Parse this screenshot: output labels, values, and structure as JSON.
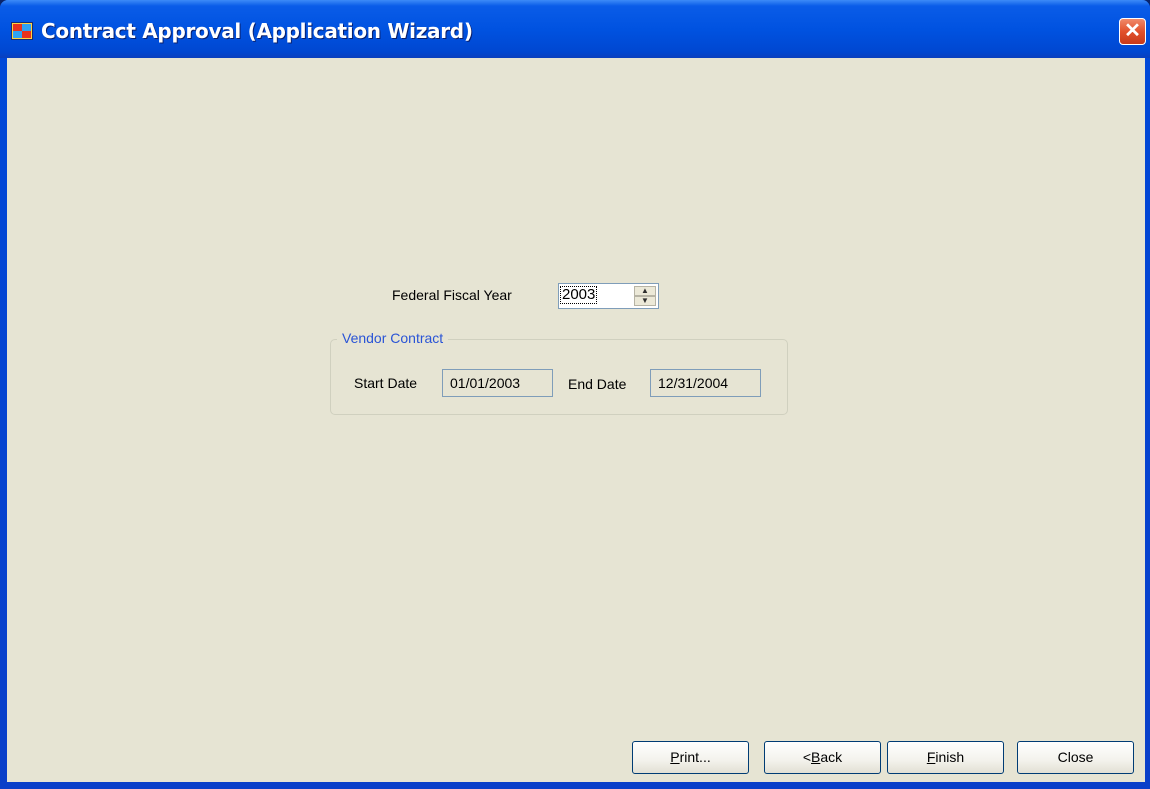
{
  "window": {
    "title": "Contract Approval (Application Wizard)",
    "icon": "application-icon",
    "close_glyph": "✕"
  },
  "form": {
    "fiscal_year_label": "Federal Fiscal Year",
    "fiscal_year_value": "2003",
    "spin_up_glyph": "▲",
    "spin_down_glyph": "▼"
  },
  "vendor_contract": {
    "group_title": "Vendor Contract",
    "start_date_label": "Start Date",
    "start_date_value": "01/01/2003",
    "end_date_label": "End Date",
    "end_date_value": "12/31/2004"
  },
  "buttons": {
    "print": {
      "mnemonic": "P",
      "rest": "rint..."
    },
    "back": {
      "prefix": "<",
      "mnemonic": "B",
      "rest": "ack"
    },
    "finish": {
      "mnemonic": "F",
      "rest": "inish"
    },
    "close": {
      "label": "Close"
    }
  },
  "colors": {
    "titlebar": "#0052e0",
    "client_bg": "#e6e4d3",
    "group_title": "#2a54d6",
    "close_button": "#e2512c"
  }
}
